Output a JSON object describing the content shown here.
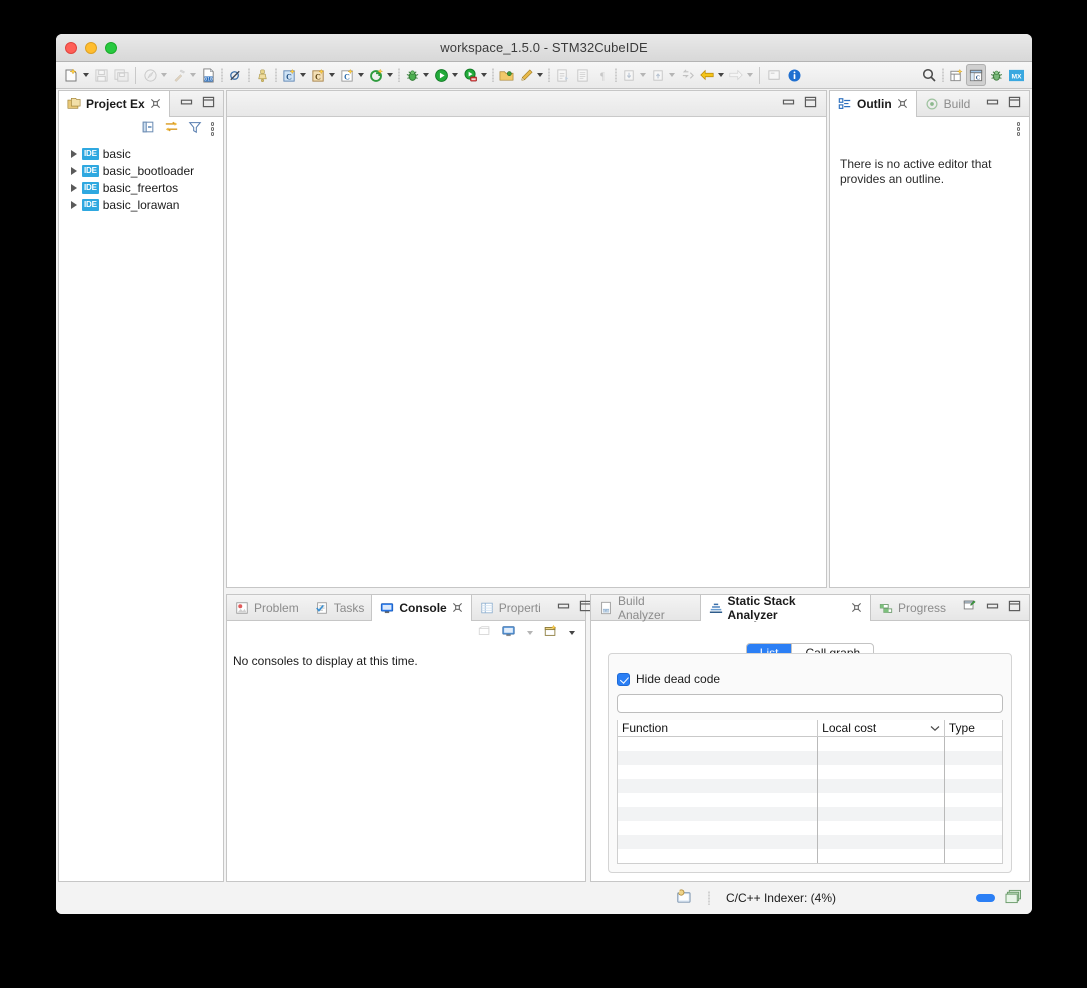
{
  "window": {
    "title": "workspace_1.5.0 - STM32CubeIDE",
    "traffic": {
      "close": "close-button",
      "minimize": "minimize-button",
      "zoom": "zoom-button"
    }
  },
  "toolbar": {
    "items": [
      {
        "name": "new-file",
        "icon": "new-file-icon",
        "caret": true,
        "enabled": true
      },
      {
        "name": "save",
        "icon": "save-icon",
        "caret": false,
        "enabled": false
      },
      {
        "name": "save-all",
        "icon": "save-all-icon",
        "caret": false,
        "enabled": false
      },
      {
        "name": "build-all",
        "icon": "build-all-icon",
        "caret": true,
        "enabled": false
      },
      {
        "name": "build",
        "icon": "hammer-icon",
        "caret": true,
        "enabled": false
      },
      {
        "name": "toggle-binary",
        "icon": "binary-icon",
        "caret": false,
        "enabled": true
      },
      {
        "name": "skip-breakpoints",
        "icon": "skip-breakpoints-icon",
        "caret": false,
        "enabled": true
      },
      {
        "name": "resume-thread",
        "icon": "thread-icon",
        "caret": false,
        "enabled": true
      },
      {
        "name": "new-c-cpp-project",
        "icon": "new-c-project-icon",
        "caret": true,
        "enabled": true
      },
      {
        "name": "new-c-cpp-file",
        "icon": "new-c-file-icon",
        "caret": true,
        "enabled": true
      },
      {
        "name": "new-class",
        "icon": "new-class-icon",
        "caret": true,
        "enabled": true
      },
      {
        "name": "new-element",
        "icon": "green-star-icon",
        "caret": true,
        "enabled": true
      },
      {
        "name": "debug",
        "icon": "debug-bug-icon",
        "caret": true,
        "enabled": true
      },
      {
        "name": "run",
        "icon": "run-play-icon",
        "caret": true,
        "enabled": true
      },
      {
        "name": "run-configurations",
        "icon": "run-external-tools-icon",
        "caret": true,
        "enabled": true
      },
      {
        "name": "open-project",
        "icon": "open-folder-icon",
        "caret": false,
        "enabled": true
      },
      {
        "name": "pencil",
        "icon": "pencil-icon",
        "caret": true,
        "enabled": true
      },
      {
        "name": "export",
        "icon": "export-icon",
        "caret": false,
        "enabled": false
      },
      {
        "name": "print",
        "icon": "print-icon",
        "caret": false,
        "enabled": false
      },
      {
        "name": "pilcrow",
        "icon": "pilcrow-icon",
        "caret": false,
        "enabled": false
      },
      {
        "name": "next-annotation",
        "icon": "next-annotation-icon",
        "caret": true,
        "enabled": false
      },
      {
        "name": "previous-annotation",
        "icon": "previous-annotation-icon",
        "caret": true,
        "enabled": false
      },
      {
        "name": "last-edit-location",
        "icon": "last-edit-icon",
        "caret": false,
        "enabled": false
      },
      {
        "name": "back",
        "icon": "back-arrow-icon",
        "caret": true,
        "enabled": true
      },
      {
        "name": "forward",
        "icon": "forward-arrow-icon",
        "caret": true,
        "enabled": false
      },
      {
        "name": "new-editor",
        "icon": "new-editor-icon",
        "caret": false,
        "enabled": false
      },
      {
        "name": "information",
        "icon": "info-icon",
        "caret": false,
        "enabled": true
      }
    ],
    "right_items": [
      {
        "name": "search",
        "icon": "search-icon",
        "pressed": false
      },
      {
        "name": "open-perspective",
        "icon": "open-perspective-icon",
        "pressed": false
      },
      {
        "name": "perspective-c-cpp",
        "icon": "c-cpp-perspective-icon",
        "pressed": true
      },
      {
        "name": "perspective-debug",
        "icon": "debug-perspective-icon",
        "pressed": false
      },
      {
        "name": "perspective-cubemx",
        "icon": "mx-perspective-icon",
        "pressed": false,
        "label": "MX"
      }
    ]
  },
  "project_explorer": {
    "tab_label": "Project Ex",
    "toolbar_icons": [
      "collapse-all-icon",
      "link-with-editor-icon",
      "filter-icon",
      "view-menu-icon"
    ],
    "tree": [
      {
        "label": "basic",
        "badge": "IDE"
      },
      {
        "label": "basic_bootloader",
        "badge": "IDE"
      },
      {
        "label": "basic_freertos",
        "badge": "IDE"
      },
      {
        "label": "basic_lorawan",
        "badge": "IDE"
      }
    ]
  },
  "editor": {
    "empty": ""
  },
  "outline": {
    "tabs": [
      {
        "label": "Outlin",
        "icon": "outline-icon",
        "active": true
      },
      {
        "label": "Build",
        "icon": "build-target-icon",
        "active": false
      }
    ],
    "message": "There is no active editor that provides an outline."
  },
  "console": {
    "tabs": [
      {
        "label": "Problem",
        "icon": "problems-icon",
        "active": false
      },
      {
        "label": "Tasks",
        "icon": "tasks-icon",
        "active": false
      },
      {
        "label": "Console",
        "icon": "console-icon",
        "active": true
      },
      {
        "label": "Properti",
        "icon": "properties-icon",
        "active": false
      }
    ],
    "toolbar_icons": [
      "clear-console-icon",
      "display-selected-console-icon",
      "open-console-icon"
    ],
    "message": "No consoles to display at this time."
  },
  "static_stack_analyzer": {
    "tabs": [
      {
        "label": "Build Analyzer",
        "icon": "build-analyzer-icon",
        "active": false
      },
      {
        "label": "Static Stack Analyzer",
        "icon": "static-stack-analyzer-icon",
        "active": true
      },
      {
        "label": "Progress",
        "icon": "progress-icon",
        "active": false
      }
    ],
    "toolbar_icons": [
      "pin-view-icon"
    ],
    "segmented": {
      "options": [
        "List",
        "Call graph"
      ],
      "selected": "List"
    },
    "hide_dead_code": {
      "label": "Hide dead code",
      "checked": true
    },
    "filter": {
      "value": "",
      "placeholder": ""
    },
    "table": {
      "columns": [
        "Function",
        "Local cost",
        "Type"
      ],
      "sorted_column": "Local cost",
      "sort_direction": "desc",
      "rows": [
        [
          "",
          "",
          ""
        ],
        [
          "",
          "",
          ""
        ],
        [
          "",
          "",
          ""
        ],
        [
          "",
          "",
          ""
        ],
        [
          "",
          "",
          ""
        ],
        [
          "",
          "",
          ""
        ],
        [
          "",
          "",
          ""
        ],
        [
          "",
          "",
          ""
        ],
        [
          "",
          "",
          ""
        ]
      ]
    }
  },
  "statusbar": {
    "indexer_icon": "indexer-icon",
    "text": "C/C++ Indexer: (4%)",
    "progress_icon": "progress-pill",
    "views_icon": "show-progress-views-icon"
  },
  "colors": {
    "accent": "#2b7ff5",
    "badge": "#2fa8e0",
    "window_bg": "#f3f3f3",
    "panel_bg": "#ffffff"
  }
}
